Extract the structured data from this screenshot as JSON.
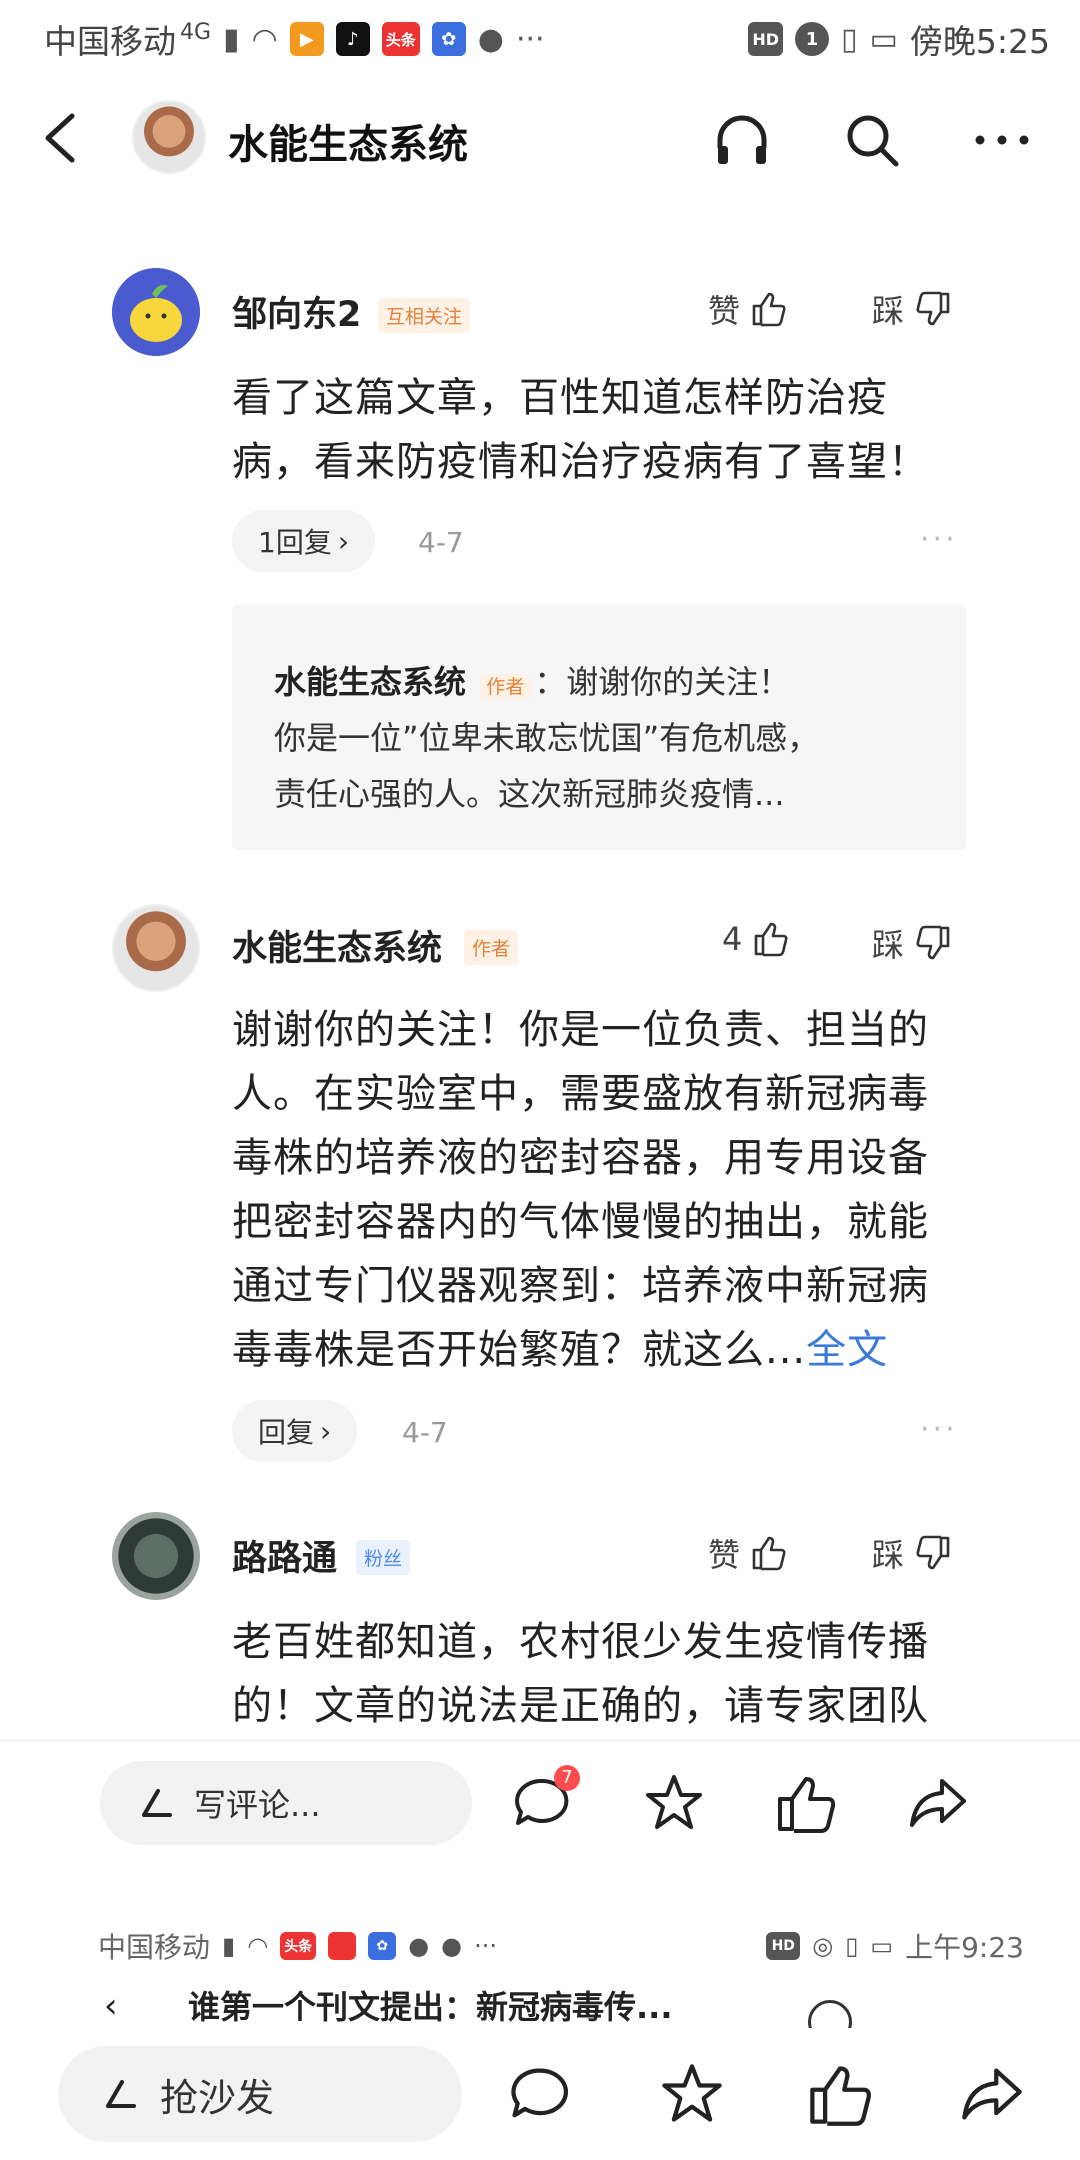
{
  "status_bar": {
    "carrier": "中国移动",
    "network": "4G",
    "time": "傍晚5:25",
    "hd": "HD",
    "sim_label": "1",
    "app_icon_toutiao": "头条"
  },
  "header": {
    "title": "水能生态系统",
    "icons": [
      "back-icon",
      "headphones-icon",
      "search-icon",
      "more-icon"
    ]
  },
  "comments": [
    {
      "author": "邹向东2",
      "tag": "互相关注",
      "like_label": "赞",
      "dislike_label": "踩",
      "body": "看了这篇文章，百性知道怎样防治疫病，看来防疫情和治疗疫病有了喜望！",
      "reply_button": "1回复",
      "date": "4-7",
      "reply": {
        "author": "水能生态系统",
        "author_tag": "作者",
        "line1": "：谢谢你的关注！",
        "line2": "你是一位”位卑未敢忘忧国”有危机感，",
        "line3": "责任心强的人。这次新冠肺炎疫情..."
      }
    },
    {
      "author": "水能生态系统",
      "tag": "作者",
      "like_count": "4",
      "dislike_label": "踩",
      "body": "谢谢你的关注！你是一位负责、担当的人。在实验室中，需要盛放有新冠病毒毒株的培养液的密封容器，用专用设备把密封容器内的气体慢慢的抽出，就能通过专门仪器观察到：培养液中新冠病毒毒株是否开始繁殖？就这么...",
      "more_label": "全文",
      "reply_button": "回复",
      "date": "4-7"
    },
    {
      "author": "路路通",
      "tag": "粉丝",
      "like_label": "赞",
      "dislike_label": "踩",
      "body": "老百姓都知道，农村很少发生疫情传播的！文章的说法是正确的，请专家团队"
    }
  ],
  "comment_bar": {
    "placeholder": "写评论...",
    "badge_count": "7"
  },
  "second_status": {
    "carrier": "中国移动",
    "time": "上午9:23",
    "hd": "HD",
    "app_icon_toutiao": "头条"
  },
  "preview_title": "谁第一个刊文提出：新冠病毒传...",
  "bottom_bar": {
    "placeholder": "抢沙发"
  },
  "colors": {
    "link": "#3b7ad8",
    "tag_orange": "#e4823a",
    "tag_blue": "#4d8be8",
    "badge_red": "#ff4d4f"
  }
}
